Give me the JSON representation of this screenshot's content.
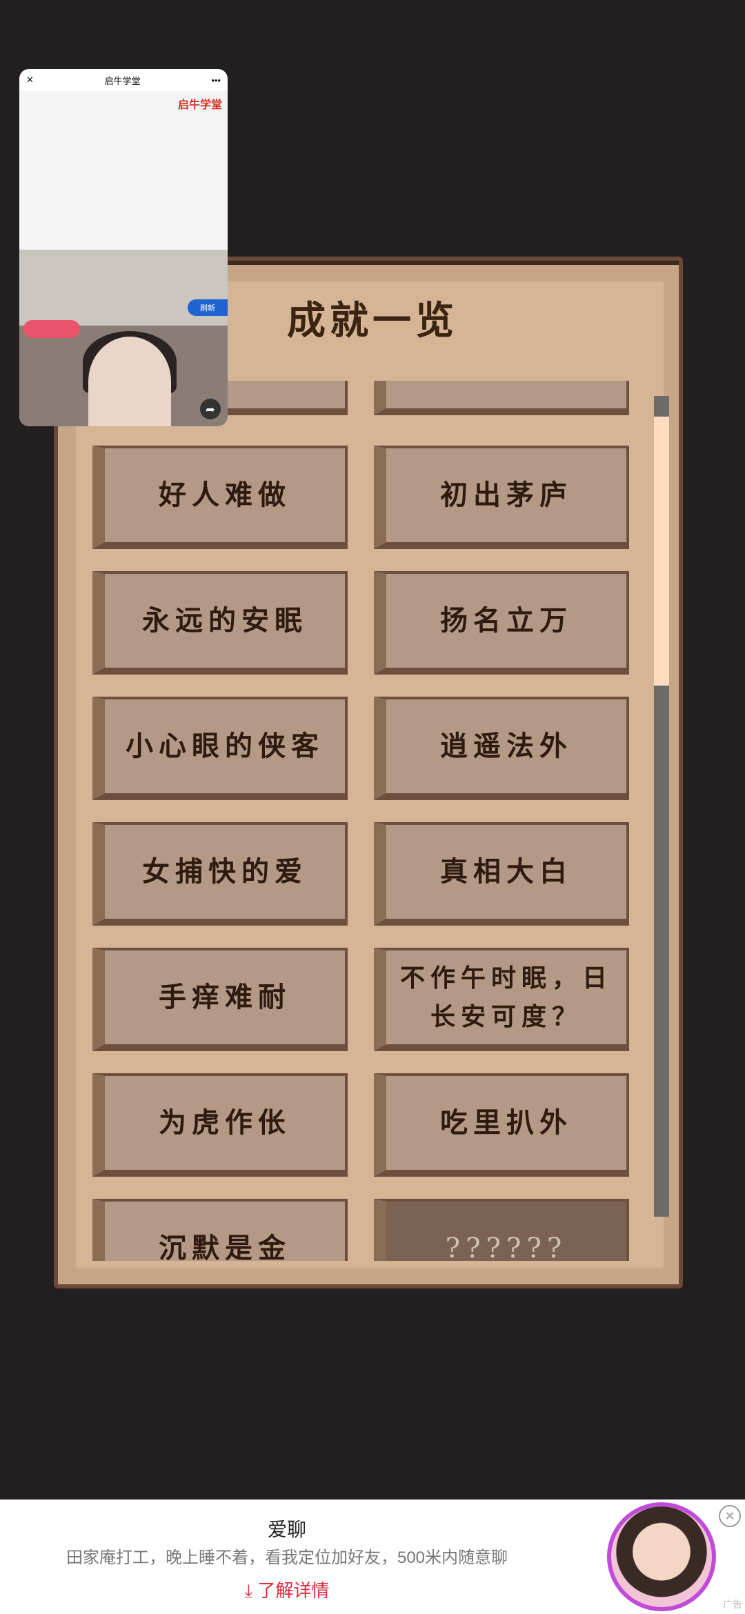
{
  "panel": {
    "title": "成就一览"
  },
  "achievements": [
    {
      "left": "好人难做",
      "right": "初出茅庐"
    },
    {
      "left": "永远的安眠",
      "right": "扬名立万"
    },
    {
      "left": "小心眼的侠客",
      "right": "逍遥法外"
    },
    {
      "left": "女捕快的爱",
      "right": "真相大白"
    },
    {
      "left": "手痒难耐",
      "right": "不作午时眠，日长安可度？"
    },
    {
      "left": "为虎作伥",
      "right": "吃里扒外"
    },
    {
      "left": "沉默是金",
      "right": "??????"
    }
  ],
  "video_window": {
    "title": "启牛学堂",
    "logo": "启牛学堂",
    "refresh_label": "刷新"
  },
  "ad": {
    "title": "爱聊",
    "description": "田家庵打工，晚上睡不着，看我定位加好友，500米内随意聊",
    "link": "了解详情",
    "tag": "广告"
  }
}
